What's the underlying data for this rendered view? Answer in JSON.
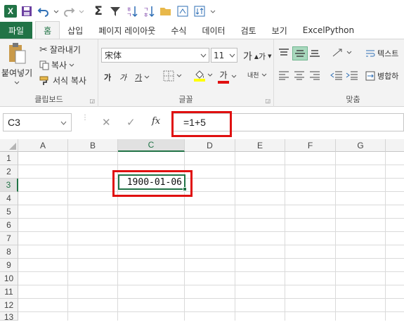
{
  "qat": {
    "app_icon_text": "X",
    "icons": [
      "save-icon",
      "undo-icon",
      "redo-icon",
      "autosum-icon",
      "filter-icon",
      "sort-asc-icon",
      "sort-desc-icon",
      "open-folder-icon",
      "screenshot-icon",
      "data-icon",
      "customize-icon"
    ]
  },
  "tabs": [
    "파일",
    "홈",
    "삽입",
    "페이지 레이아웃",
    "수식",
    "데이터",
    "검토",
    "보기",
    "ExcelPython"
  ],
  "ribbon": {
    "paste_label": "붙여넣기",
    "cut_label": "잘라내기",
    "copy_label": "복사",
    "format_painter_label": "서식 복사",
    "clipboard_group": "클립보드",
    "font_name": "宋体",
    "font_size": "11",
    "grow_font": "가",
    "shrink_font": "가",
    "bold": "가",
    "italic": "가",
    "underline": "가",
    "font_color_glyph": "가",
    "phonetic": "내천",
    "font_group": "글꼴",
    "wrap_text_label": "텍스트",
    "merge_label": "병합하",
    "align_group": "맞춤"
  },
  "formula_bar": {
    "name_box": "C3",
    "cancel": "✕",
    "enter": "✓",
    "fx": "fx",
    "formula": "=1+5"
  },
  "grid": {
    "columns": [
      "A",
      "B",
      "C",
      "D",
      "E",
      "F",
      "G"
    ],
    "rows": [
      "1",
      "2",
      "3",
      "4",
      "5",
      "6",
      "7",
      "8",
      "9",
      "10",
      "11",
      "12",
      "13"
    ],
    "selected_column": "C",
    "selected_row": "3",
    "active_cell_value": "1900-01-06"
  },
  "colors": {
    "accent": "#217346",
    "highlight_box": "#e01010",
    "font_color": "#e01010",
    "fill_color": "#ffff00"
  }
}
